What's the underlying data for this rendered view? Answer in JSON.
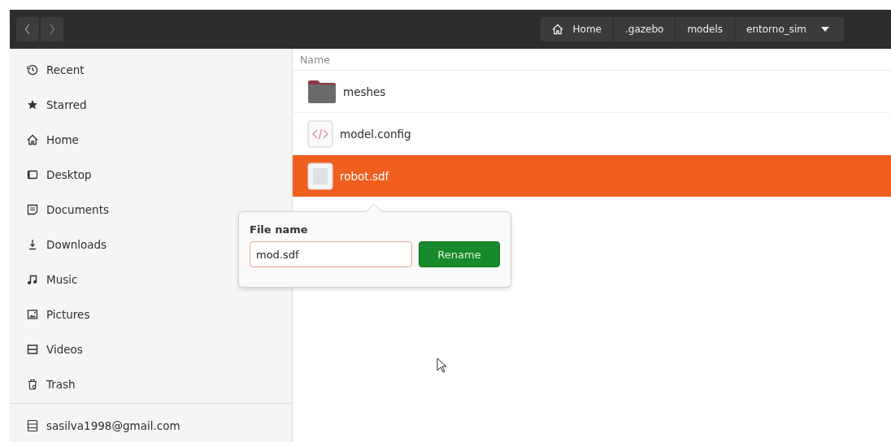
{
  "breadcrumbs": [
    {
      "label": "Home",
      "kind": "home"
    },
    {
      "label": ".gazebo",
      "kind": "folder"
    },
    {
      "label": "models",
      "kind": "folder"
    },
    {
      "label": "entorno_sim",
      "kind": "current"
    }
  ],
  "sidebar": {
    "items": [
      {
        "label": "Recent",
        "kind": "recent"
      },
      {
        "label": "Starred",
        "kind": "starred"
      },
      {
        "label": "Home",
        "kind": "home"
      },
      {
        "label": "Desktop",
        "kind": "desktop"
      },
      {
        "label": "Documents",
        "kind": "documents"
      },
      {
        "label": "Downloads",
        "kind": "downloads"
      },
      {
        "label": "Music",
        "kind": "music"
      },
      {
        "label": "Pictures",
        "kind": "pictures"
      },
      {
        "label": "Videos",
        "kind": "videos"
      },
      {
        "label": "Trash",
        "kind": "trash"
      }
    ],
    "account": "sasilva1998@gmail.com"
  },
  "list": {
    "column": "Name",
    "rows": [
      {
        "name": "meshes",
        "kind": "folder",
        "selected": false
      },
      {
        "name": "model.config",
        "kind": "code",
        "selected": false
      },
      {
        "name": "robot.sdf",
        "kind": "file",
        "selected": true
      }
    ]
  },
  "rename_popover": {
    "label": "File name",
    "value": "mod.sdf",
    "button": "Rename"
  }
}
